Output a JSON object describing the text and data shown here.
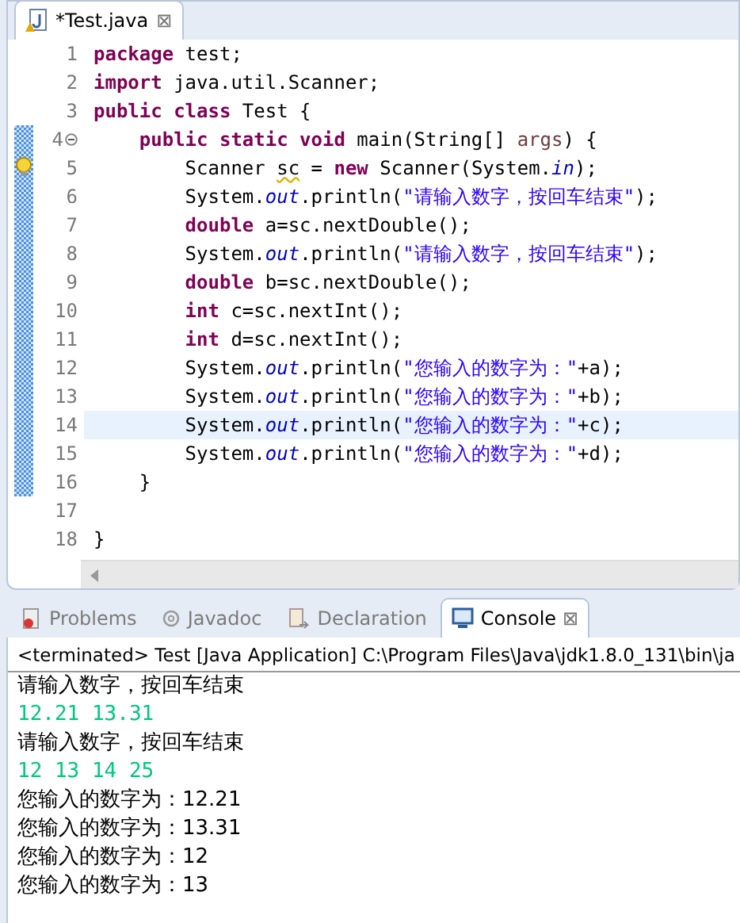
{
  "editor": {
    "tab": {
      "title": "*Test.java",
      "close": "⊠"
    },
    "lines": [
      {
        "number": "1",
        "changed": false,
        "current": false,
        "tokens": [
          {
            "kind": "keyword",
            "text": "package"
          },
          {
            "kind": "plain",
            "text": " test;"
          }
        ]
      },
      {
        "number": "2",
        "changed": false,
        "current": false,
        "tokens": [
          {
            "kind": "keyword",
            "text": "import"
          },
          {
            "kind": "plain",
            "text": " java.util.Scanner;"
          }
        ]
      },
      {
        "number": "3",
        "changed": false,
        "current": false,
        "tokens": [
          {
            "kind": "keyword",
            "text": "public class"
          },
          {
            "kind": "plain",
            "text": " Test {"
          }
        ]
      },
      {
        "number": "4",
        "changed": true,
        "current": false,
        "folding": true,
        "warning": false,
        "tokens": [
          {
            "kind": "keyword",
            "text": "    public static void"
          },
          {
            "kind": "plain",
            "text": " main(String[] "
          },
          {
            "kind": "param",
            "text": "args"
          },
          {
            "kind": "plain",
            "text": ") {"
          }
        ]
      },
      {
        "number": "5",
        "changed": true,
        "current": false,
        "folding": false,
        "warning": true,
        "tokens": [
          {
            "kind": "plain",
            "text": "        Scanner "
          },
          {
            "kind": "warned",
            "text": "sc"
          },
          {
            "kind": "plain",
            "text": " = "
          },
          {
            "kind": "keyword",
            "text": "new"
          },
          {
            "kind": "plain",
            "text": " Scanner(System."
          },
          {
            "kind": "field",
            "text": "in"
          },
          {
            "kind": "plain",
            "text": ");"
          }
        ]
      },
      {
        "number": "6",
        "changed": true,
        "current": false,
        "tokens": [
          {
            "kind": "plain",
            "text": "        System."
          },
          {
            "kind": "field",
            "text": "out"
          },
          {
            "kind": "plain",
            "text": ".println("
          },
          {
            "kind": "string",
            "text": "\"请输入数字，按回车结束\""
          },
          {
            "kind": "plain",
            "text": ");"
          }
        ]
      },
      {
        "number": "7",
        "changed": true,
        "current": false,
        "tokens": [
          {
            "kind": "keyword",
            "text": "        double"
          },
          {
            "kind": "plain",
            "text": " a=sc.nextDouble();"
          }
        ]
      },
      {
        "number": "8",
        "changed": true,
        "current": false,
        "tokens": [
          {
            "kind": "plain",
            "text": "        System."
          },
          {
            "kind": "field",
            "text": "out"
          },
          {
            "kind": "plain",
            "text": ".println("
          },
          {
            "kind": "string",
            "text": "\"请输入数字，按回车结束\""
          },
          {
            "kind": "plain",
            "text": ");"
          }
        ]
      },
      {
        "number": "9",
        "changed": true,
        "current": false,
        "tokens": [
          {
            "kind": "keyword",
            "text": "        double"
          },
          {
            "kind": "plain",
            "text": " b=sc.nextDouble();"
          }
        ]
      },
      {
        "number": "10",
        "changed": true,
        "current": false,
        "tokens": [
          {
            "kind": "keyword",
            "text": "        int"
          },
          {
            "kind": "plain",
            "text": " c=sc.nextInt();"
          }
        ]
      },
      {
        "number": "11",
        "changed": true,
        "current": false,
        "tokens": [
          {
            "kind": "keyword",
            "text": "        int"
          },
          {
            "kind": "plain",
            "text": " d=sc.nextInt();"
          }
        ]
      },
      {
        "number": "12",
        "changed": true,
        "current": false,
        "tokens": [
          {
            "kind": "plain",
            "text": "        System."
          },
          {
            "kind": "field",
            "text": "out"
          },
          {
            "kind": "plain",
            "text": ".println("
          },
          {
            "kind": "string",
            "text": "\"您输入的数字为：\""
          },
          {
            "kind": "plain",
            "text": "+a);"
          }
        ]
      },
      {
        "number": "13",
        "changed": true,
        "current": false,
        "tokens": [
          {
            "kind": "plain",
            "text": "        System."
          },
          {
            "kind": "field",
            "text": "out"
          },
          {
            "kind": "plain",
            "text": ".println("
          },
          {
            "kind": "string",
            "text": "\"您输入的数字为：\""
          },
          {
            "kind": "plain",
            "text": "+b);"
          }
        ]
      },
      {
        "number": "14",
        "changed": true,
        "current": true,
        "tokens": [
          {
            "kind": "plain",
            "text": "        System."
          },
          {
            "kind": "field",
            "text": "out"
          },
          {
            "kind": "plain",
            "text": ".println("
          },
          {
            "kind": "string",
            "text": "\"您输入的数字为：\""
          },
          {
            "kind": "plain",
            "text": "+c);"
          }
        ]
      },
      {
        "number": "15",
        "changed": true,
        "current": false,
        "tokens": [
          {
            "kind": "plain",
            "text": "        System."
          },
          {
            "kind": "field",
            "text": "out"
          },
          {
            "kind": "plain",
            "text": ".println("
          },
          {
            "kind": "string",
            "text": "\"您输入的数字为：\""
          },
          {
            "kind": "plain",
            "text": "+d);"
          }
        ]
      },
      {
        "number": "16",
        "changed": true,
        "current": false,
        "tokens": [
          {
            "kind": "plain",
            "text": "    }"
          }
        ]
      },
      {
        "number": "17",
        "changed": false,
        "current": false
      },
      {
        "number": "18",
        "changed": false,
        "current": false,
        "tokens": [
          {
            "kind": "plain",
            "text": "}"
          }
        ]
      }
    ]
  },
  "views": {
    "tabs": [
      {
        "label": "Problems",
        "selected": false
      },
      {
        "label": "Javadoc",
        "selected": false
      },
      {
        "label": "Declaration",
        "selected": false
      },
      {
        "label": "Console",
        "selected": true,
        "close": "⊠"
      }
    ]
  },
  "console": {
    "header": "<terminated> Test [Java Application] C:\\Program Files\\Java\\jdk1.8.0_131\\bin\\ja",
    "lines": [
      {
        "kind": "output",
        "text": "请输入数字，按回车结束"
      },
      {
        "kind": "input",
        "text": "12.21 13.31"
      },
      {
        "kind": "output",
        "text": "请输入数字，按回车结束"
      },
      {
        "kind": "input",
        "text": "12 13 14 25"
      },
      {
        "kind": "output",
        "text": "您输入的数字为：12.21"
      },
      {
        "kind": "output",
        "text": "您输入的数字为：13.31"
      },
      {
        "kind": "output",
        "text": "您输入的数字为：12"
      },
      {
        "kind": "output",
        "text": "您输入的数字为：13"
      }
    ]
  }
}
